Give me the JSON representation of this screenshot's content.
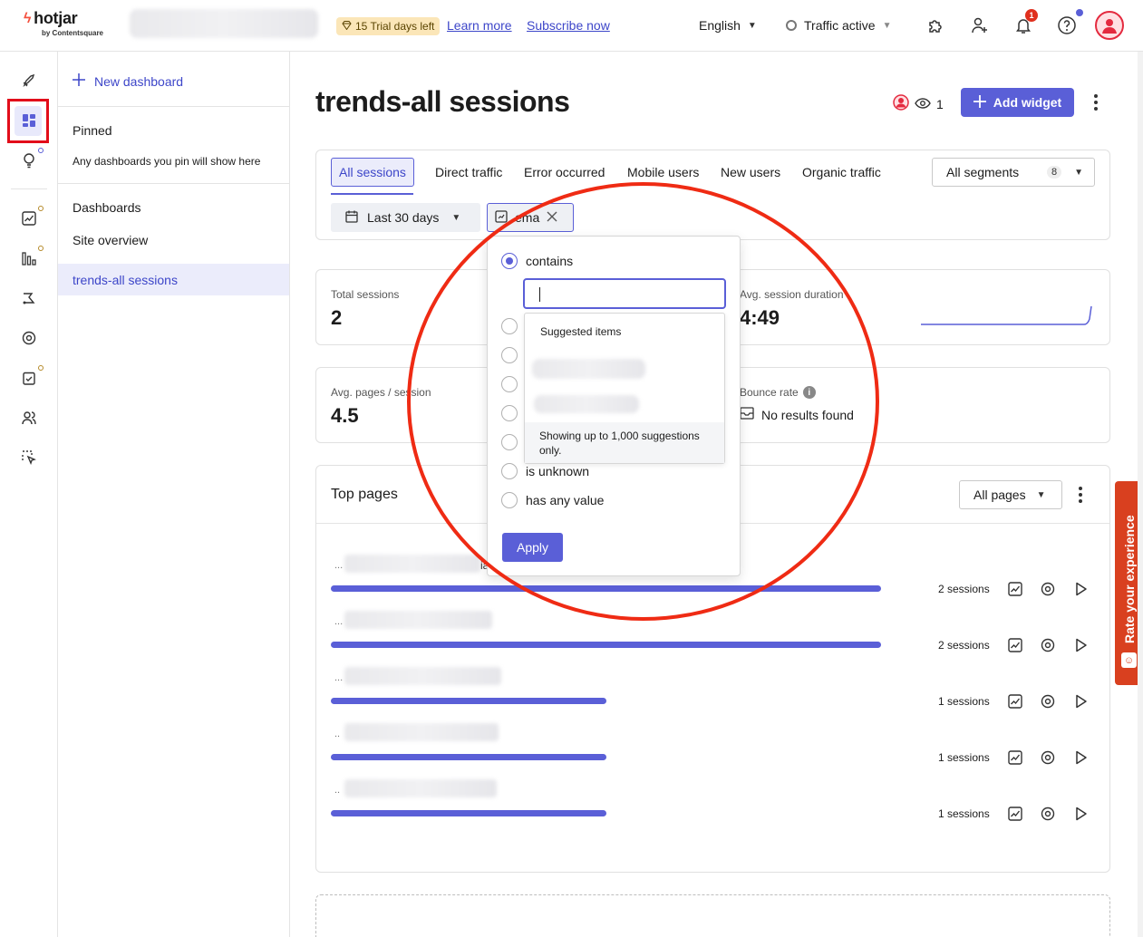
{
  "topbar": {
    "logo_text": "hotjar",
    "logo_sub": "by Contentsquare",
    "trial_badge": "15 Trial days left",
    "learn_more": "Learn more",
    "subscribe_now": "Subscribe now",
    "language": "English",
    "traffic": "Traffic active",
    "notification_count": "1"
  },
  "sidebar": {
    "new_dashboard": "New dashboard",
    "pinned_heading": "Pinned",
    "pinned_note": "Any dashboards you pin will show here",
    "dashboards_heading": "Dashboards",
    "site_overview": "Site overview",
    "active_item": "trends-all sessions"
  },
  "main": {
    "title": "trends-all sessions",
    "viewer_count": "1",
    "add_widget": "Add widget",
    "segments": {
      "tabs": [
        "All sessions",
        "Direct traffic",
        "Error occurred",
        "Mobile users",
        "New users",
        "Organic traffic"
      ],
      "select_label": "All segments",
      "select_count": "8"
    },
    "filters": {
      "date": "Last 30 days",
      "email": "ema"
    },
    "metrics": {
      "total_sessions_label": "Total sessions",
      "total_sessions_value": "2",
      "avg_duration_label": "Avg. session duration",
      "avg_duration_value": "4:49",
      "avg_pages_label": "Avg. pages / session",
      "avg_pages_value": "4.5",
      "bounce_label": "Bounce rate",
      "bounce_value": "No results found"
    },
    "top_pages": {
      "title": "Top pages",
      "select_label": "All pages",
      "rows": [
        {
          "url_prefix": "...",
          "url_suffix": "ia",
          "sessions": "2 sessions",
          "share": 1.0
        },
        {
          "url_prefix": "...",
          "url_suffix": "",
          "sessions": "2 sessions",
          "share": 1.0
        },
        {
          "url_prefix": "...",
          "url_suffix": "",
          "sessions": "1 sessions",
          "share": 0.5
        },
        {
          "url_prefix": "..",
          "url_suffix": "",
          "sessions": "1 sessions",
          "share": 0.5
        },
        {
          "url_prefix": "..",
          "url_suffix": "",
          "sessions": "1 sessions",
          "share": 0.5
        }
      ]
    }
  },
  "dropdown": {
    "options": [
      "contains",
      "is unknown",
      "has any value"
    ],
    "selected": "contains",
    "input_value": "",
    "suggested_title": "Suggested items",
    "suggest_footer": "Showing up to 1,000 suggestions only.",
    "apply": "Apply"
  },
  "feedback_tab": "Rate your experience",
  "colors": {
    "accent": "#5a5fd7",
    "annotation_red": "#ef2b14",
    "feedback": "#d9401f"
  }
}
